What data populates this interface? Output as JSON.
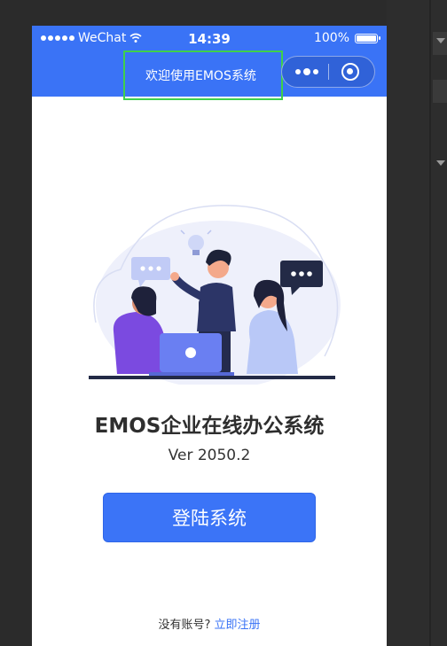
{
  "statusbar": {
    "carrier": "WeChat",
    "time": "14:39",
    "battery": "100%",
    "battery_level": 1.0
  },
  "navbar": {
    "title": "欢迎使用EMOS系统"
  },
  "main": {
    "app_title": "EMOS企业在线办公系统",
    "version": "Ver 2050.2",
    "login_button": "登陆系统",
    "no_account_text": "没有账号?",
    "register_link": "立即注册"
  },
  "colors": {
    "brand": "#3a73f6",
    "highlight": "#3fd04b"
  },
  "icons": [
    "signal-dots-icon",
    "wifi-icon",
    "battery-icon",
    "more-icon",
    "close-icon"
  ]
}
